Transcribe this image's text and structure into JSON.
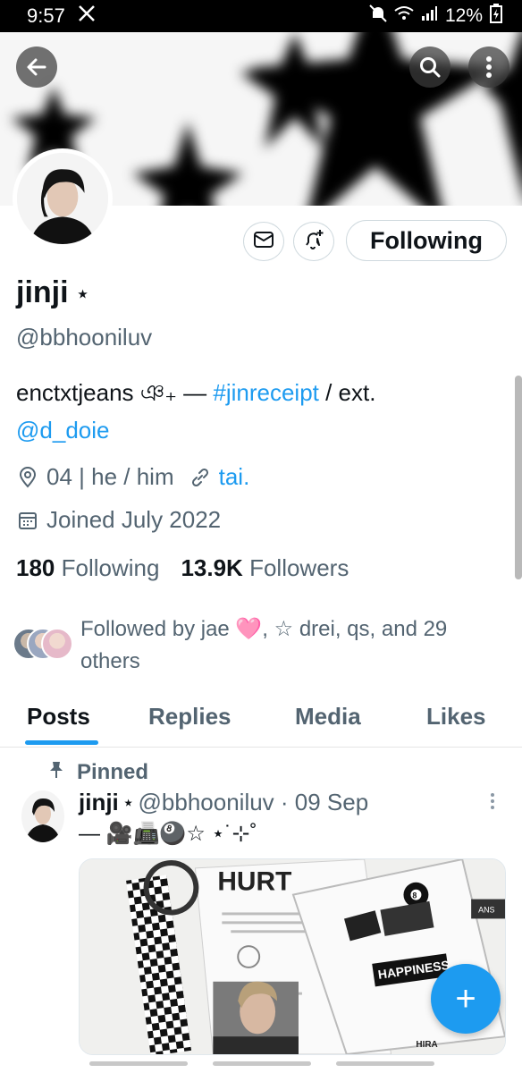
{
  "status_bar": {
    "time": "9:57",
    "app_icon": "x-logo-icon",
    "battery": "12%",
    "icons": [
      "mute-icon",
      "wifi-icon",
      "signal-icon",
      "battery-charging-icon"
    ]
  },
  "header": {
    "back_icon": "back-arrow-icon",
    "search_icon": "search-icon",
    "more_icon": "more-vertical-icon"
  },
  "actions": {
    "message_icon": "envelope-icon",
    "notify_icon": "bell-plus-icon",
    "following_label": "Following"
  },
  "profile": {
    "name": "jinji",
    "name_suffix": "⭑",
    "handle": "@bbhooniluv",
    "bio_prefix": "enctxtjeans ঞ₊ — ",
    "bio_hashtag": "#jinreceipt",
    "bio_suffix": " / ext.",
    "bio_mention": "@d_doie",
    "location": "04 | he / him",
    "website": "tai.",
    "joined": "Joined July 2022",
    "following_count": "180",
    "following_label": "Following",
    "followers_count": "13.9K",
    "followers_label": "Followers",
    "followed_by": "Followed by jae 🩷, ☆ drei, qs, and 29 others"
  },
  "tabs": [
    {
      "label": "Posts",
      "active": true
    },
    {
      "label": "Replies",
      "active": false
    },
    {
      "label": "Media",
      "active": false
    },
    {
      "label": "Likes",
      "active": false
    }
  ],
  "post": {
    "pinned_label": "Pinned",
    "author": "jinji",
    "author_suffix": "⭑",
    "meta": "@bbhooniluv · 09 Sep",
    "text": "— 🎥📠🎱☆ ⋆˙⊹˚",
    "menu_icon": "more-vertical-icon"
  },
  "fab": {
    "label": "+",
    "icon": "plus-icon"
  },
  "colors": {
    "accent": "#1d9bf0",
    "text": "#0f1419",
    "muted": "#536471"
  }
}
